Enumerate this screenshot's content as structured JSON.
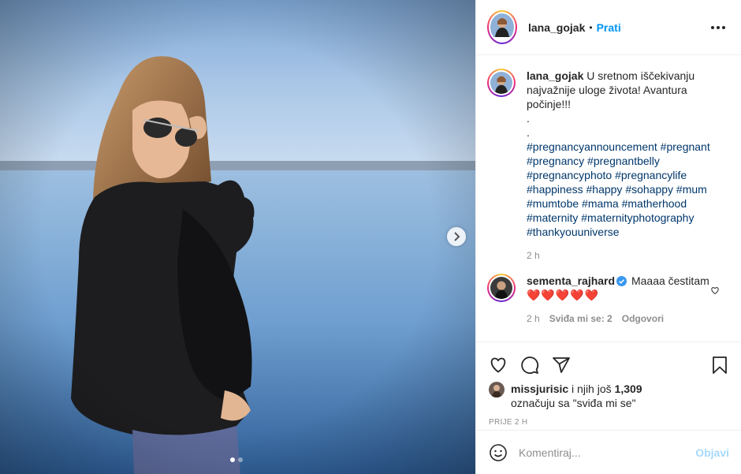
{
  "post": {
    "image_alt": "",
    "carousel": {
      "count": 2,
      "active": 1
    }
  },
  "header": {
    "username": "lana_gojak",
    "separator": "•",
    "follow_label": "Prati",
    "more_icon": "more-horizontal-icon"
  },
  "caption": {
    "username": "lana_gojak",
    "text": "U sretnom iščekivanju najvažnije uloge života! Avantura počinje!!!",
    "dot1": ".",
    "dot2": ".",
    "hashtags": "#pregnancyannouncement #pregnant #pregnancy #pregnantbelly #pregnancyphoto #pregnancylife #happiness #happy #sohappy #mum #mumtobe #mama #matherhood #maternity #maternityphotography #thankyouuniverse",
    "time": "2 h"
  },
  "comment": {
    "username": "sementa_rajhard",
    "text_prefix": "Maaaa čestitam",
    "hearts": "❤️❤️❤️❤️❤️",
    "time": "2 h",
    "likes_label": "Sviđa mi se: 2",
    "reply_label": "Odgovori"
  },
  "likes": {
    "user": "missjurisic",
    "rest": "i njih još",
    "count": "1,309",
    "suffix": "označuju sa \"sviđa mi se\""
  },
  "posted": "PRIJE 2 H",
  "add_comment": {
    "placeholder": "Komentiraj...",
    "post_label": "Objavi"
  },
  "colors": {
    "accent": "#0095f6",
    "hashtag": "#00376b",
    "heart": "#ed4956",
    "muted": "#8e8e8e"
  }
}
